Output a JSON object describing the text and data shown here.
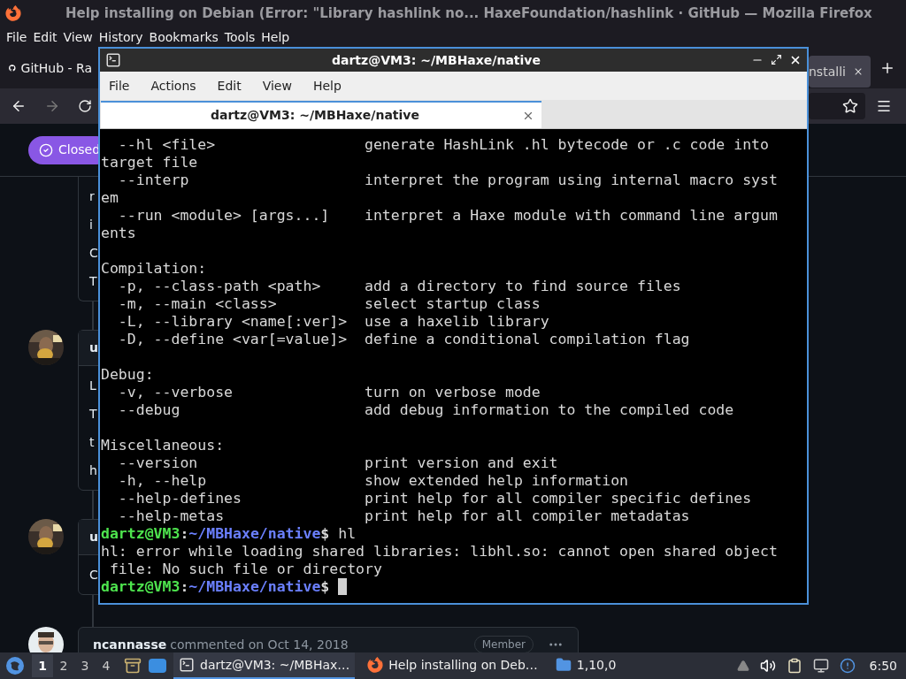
{
  "browser": {
    "title": "Help installing on Debian (Error: \"Library hashlink no... HaxeFoundation/hashlink · GitHub — Mozilla Firefox",
    "menu": [
      "File",
      "Edit",
      "View",
      "History",
      "Bookmarks",
      "Tools",
      "Help"
    ],
    "tabs": [
      {
        "label": "GitHub - Ra",
        "selected": false
      },
      {
        "label": "nstalli",
        "selected": true
      }
    ]
  },
  "page": {
    "status_badge": "Closed",
    "comments": [
      {
        "lines": [
          "r",
          "i",
          "C",
          "T"
        ]
      },
      {
        "header": "u",
        "lines": [
          "L",
          "T",
          "t",
          "h"
        ]
      },
      {
        "header": "u",
        "lines": [
          "C"
        ]
      }
    ],
    "last_comment": {
      "author": "ncannasse",
      "action": "commented on Oct 14, 2018",
      "badge": "Member"
    }
  },
  "terminal": {
    "title": "dartz@VM3: ~/MBHaxe/native",
    "menu": [
      "File",
      "Actions",
      "Edit",
      "View",
      "Help"
    ],
    "tab": {
      "label": "dartz@VM3: ~/MBHaxe/native",
      "selected": true
    },
    "lines": [
      {
        "kind": "option",
        "option": "--hl <file>",
        "description": "generate HashLink .hl bytecode or .c code into"
      },
      {
        "kind": "text",
        "text": "target file"
      },
      {
        "kind": "option",
        "option": "--interp",
        "description": "interpret the program using internal macro syst"
      },
      {
        "kind": "text",
        "text": "em"
      },
      {
        "kind": "option",
        "option": "--run <module> [args...]",
        "description": "interpret a Haxe module with command line argum"
      },
      {
        "kind": "text",
        "text": "ents"
      },
      {
        "kind": "blank"
      },
      {
        "kind": "text",
        "text": "Compilation:"
      },
      {
        "kind": "option",
        "option": "-p, --class-path <path>",
        "description": "add a directory to find source files"
      },
      {
        "kind": "option",
        "option": "-m, --main <class>",
        "description": "select startup class"
      },
      {
        "kind": "option",
        "option": "-L, --library <name[:ver]>",
        "description": "use a haxelib library"
      },
      {
        "kind": "option",
        "option": "-D, --define <var[=value]>",
        "description": "define a conditional compilation flag"
      },
      {
        "kind": "blank"
      },
      {
        "kind": "text",
        "text": "Debug:"
      },
      {
        "kind": "option",
        "option": "-v, --verbose",
        "description": "turn on verbose mode"
      },
      {
        "kind": "option",
        "option": "--debug",
        "description": "add debug information to the compiled code"
      },
      {
        "kind": "blank"
      },
      {
        "kind": "text",
        "text": "Miscellaneous:"
      },
      {
        "kind": "option",
        "option": "--version",
        "description": "print version and exit"
      },
      {
        "kind": "option",
        "option": "-h, --help",
        "description": "show extended help information"
      },
      {
        "kind": "option",
        "option": "--help-defines",
        "description": "print help for all compiler specific defines"
      },
      {
        "kind": "option",
        "option": "--help-metas",
        "description": "print help for all compiler metadatas"
      },
      {
        "kind": "prompt",
        "user": "dartz@VM3",
        "separator": ":",
        "path": "~/MBHaxe/native",
        "symbol": "$",
        "command": "hl"
      },
      {
        "kind": "text",
        "text": "hl: error while loading shared libraries: libhl.so: cannot open shared object"
      },
      {
        "kind": "text",
        "text": " file: No such file or directory"
      },
      {
        "kind": "prompt",
        "user": "dartz@VM3",
        "separator": ":",
        "path": "~/MBHaxe/native",
        "symbol": "$",
        "cursor": true
      }
    ]
  },
  "taskbar": {
    "workspaces": [
      {
        "label": "1",
        "selected": true
      },
      {
        "label": "2",
        "selected": false
      },
      {
        "label": "3",
        "selected": false
      },
      {
        "label": "4",
        "selected": false
      }
    ],
    "tasks": [
      {
        "kind": "terminal",
        "label": "dartz@VM3: ~/MBHax…",
        "selected": true
      },
      {
        "kind": "firefox",
        "label": "Help installing on Deb…",
        "selected": false
      },
      {
        "kind": "folder",
        "label": "1,10,0",
        "selected": false
      }
    ],
    "clock": "6:50"
  }
}
